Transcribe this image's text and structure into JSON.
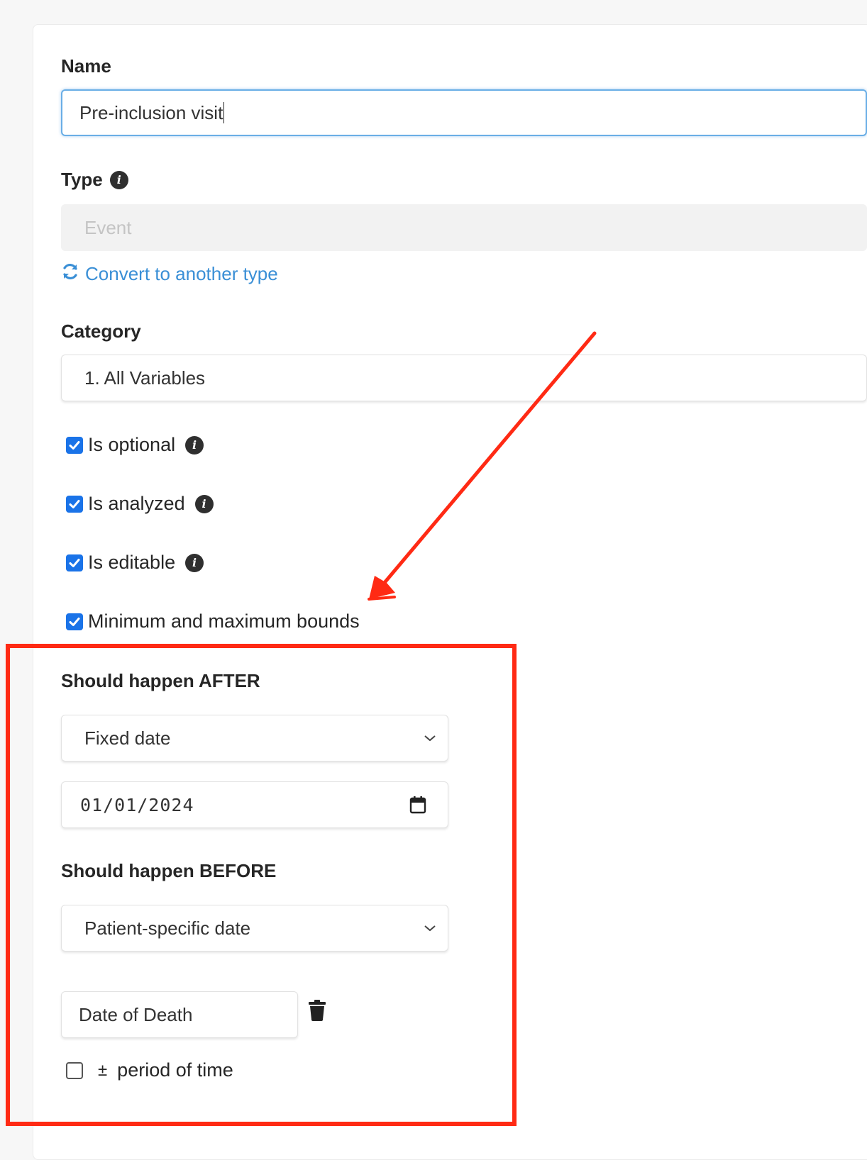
{
  "form": {
    "name": {
      "label": "Name",
      "value": "Pre-inclusion visit"
    },
    "type": {
      "label": "Type",
      "value": "Event",
      "convert_link": "Convert to another type"
    },
    "category": {
      "label": "Category",
      "value": "1. All Variables"
    },
    "checkboxes": [
      {
        "label": "Is optional",
        "checked": true
      },
      {
        "label": "Is analyzed",
        "checked": true
      },
      {
        "label": "Is editable",
        "checked": true
      },
      {
        "label": "Minimum and maximum bounds",
        "checked": true
      }
    ],
    "after": {
      "label": "Should happen AFTER",
      "select_value": "Fixed date",
      "date_value": "01/01/2024"
    },
    "before": {
      "label": "Should happen BEFORE",
      "select_value": "Patient-specific date",
      "variable_value": "Date of Death"
    },
    "period": {
      "symbol": "±",
      "label": "period of time",
      "checked": false
    }
  },
  "annotation": {
    "color": "#ff2a14"
  },
  "colors": {
    "accent": "#1a73e8",
    "link": "#3a8fd6",
    "focus": "#6aaee6"
  },
  "icons": [
    "info-icon",
    "refresh-icon",
    "chevron-down-icon",
    "calendar-icon",
    "trash-icon",
    "check-icon"
  ]
}
